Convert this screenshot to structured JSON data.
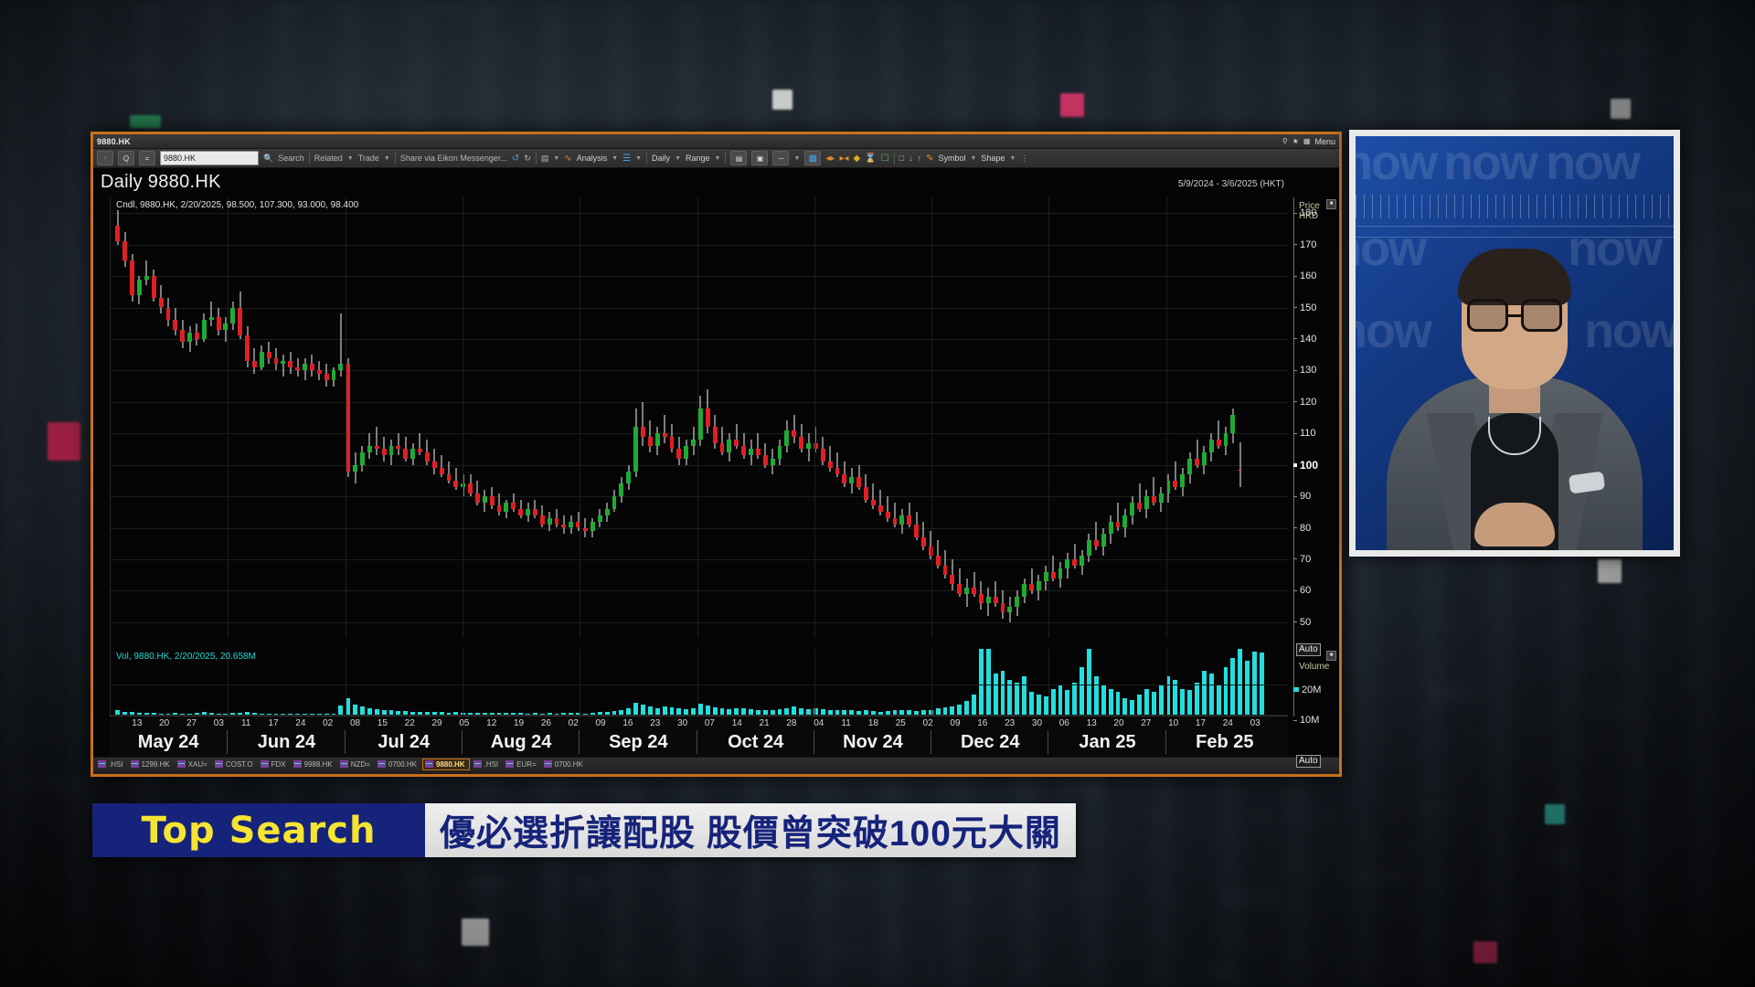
{
  "window": {
    "title": "9880.HK",
    "menu_label": "Menu",
    "titlebar_icons": [
      "pin-icon",
      "star-icon",
      "layout-icon"
    ]
  },
  "toolbar": {
    "up_arrow_icon": "↑",
    "quote_icon": "Q",
    "equals_icon": "=",
    "symbol_value": "9880.HK",
    "search_icon": "search-icon",
    "links": [
      "Search",
      "Related",
      "Trade",
      "Share via Eikon Messenger..."
    ],
    "undo_icon": "↺",
    "redo_icon": "↻",
    "folder_icon": "▤",
    "analysis_label": "Analysis",
    "layers_icon": "☰",
    "interval_label": "Daily",
    "range_label": "Range",
    "symbol_label": "Symbol",
    "shape_label": "Shape",
    "more_icon": "⋮"
  },
  "chart": {
    "heading": "Daily 9880.HK",
    "date_range": "5/9/2024 - 3/6/2025 (HKT)",
    "price_legend": "Cndl, 9880.HK, 2/20/2025, 98.500, 107.300, 93.000, 98.400",
    "volume_legend": "Vol, 9880.HK, 2/20/2025, 20.658M",
    "price_axis_caption": [
      "Price",
      "HKD"
    ],
    "volume_axis_caption": "Volume",
    "auto_label": "Auto",
    "price_ticks": [
      180,
      170,
      160,
      150,
      140,
      130,
      120,
      110,
      100,
      90,
      80,
      70,
      60,
      50
    ],
    "highlight_price": 100,
    "volume_ticks": [
      "20M",
      "10M"
    ],
    "colors": {
      "up": "#1faa34",
      "down": "#e01f22",
      "wick": "#f2f2f2",
      "volume": "#23dede",
      "background": "#050505",
      "window_border": "#c8701a"
    }
  },
  "chart_data": {
    "type": "line",
    "subtype": "candlestick-with-volume",
    "title": "Daily 9880.HK",
    "subtitle": "5/9/2024 - 3/6/2025 (HKT)",
    "xlabel": "",
    "ylabel": "Price HKD",
    "ylim": [
      45,
      185
    ],
    "grid": true,
    "legend_position": "top-left",
    "instrument": "9880.HK",
    "currency": "HKD",
    "latest_quote": {
      "date": "2/20/2025",
      "open": 98.5,
      "high": 107.3,
      "low": 93.0,
      "close": 98.4,
      "volume": "20.658M"
    },
    "price_tick_labels": [
      180,
      170,
      160,
      150,
      140,
      130,
      120,
      110,
      100,
      90,
      80,
      70,
      60,
      50
    ],
    "volume_tick_labels": [
      "20M",
      "10M"
    ],
    "months": [
      "May 24",
      "Jun 24",
      "Jul 24",
      "Aug 24",
      "Sep 24",
      "Oct 24",
      "Nov 24",
      "Dec 24",
      "Jan 25",
      "Feb 25"
    ],
    "day_ticks": [
      "13",
      "20",
      "27",
      "03",
      "11",
      "17",
      "24",
      "02",
      "08",
      "15",
      "22",
      "29",
      "05",
      "12",
      "19",
      "26",
      "02",
      "09",
      "16",
      "23",
      "30",
      "07",
      "14",
      "21",
      "28",
      "04",
      "11",
      "18",
      "25",
      "02",
      "09",
      "16",
      "23",
      "30",
      "06",
      "13",
      "20",
      "27",
      "10",
      "17",
      "24",
      "03"
    ],
    "candles": [
      {
        "o": 176,
        "h": 181,
        "l": 170,
        "c": 171
      },
      {
        "o": 171,
        "h": 174,
        "l": 163,
        "c": 165
      },
      {
        "o": 165,
        "h": 167,
        "l": 152,
        "c": 154
      },
      {
        "o": 154,
        "h": 160,
        "l": 151,
        "c": 159
      },
      {
        "o": 159,
        "h": 165,
        "l": 157,
        "c": 160
      },
      {
        "o": 160,
        "h": 162,
        "l": 152,
        "c": 153
      },
      {
        "o": 153,
        "h": 157,
        "l": 148,
        "c": 150
      },
      {
        "o": 150,
        "h": 153,
        "l": 144,
        "c": 146
      },
      {
        "o": 146,
        "h": 150,
        "l": 141,
        "c": 143
      },
      {
        "o": 143,
        "h": 146,
        "l": 137,
        "c": 139
      },
      {
        "o": 139,
        "h": 144,
        "l": 136,
        "c": 142
      },
      {
        "o": 142,
        "h": 145,
        "l": 138,
        "c": 140
      },
      {
        "o": 140,
        "h": 148,
        "l": 139,
        "c": 146
      },
      {
        "o": 146,
        "h": 152,
        "l": 144,
        "c": 147
      },
      {
        "o": 147,
        "h": 150,
        "l": 141,
        "c": 143
      },
      {
        "o": 143,
        "h": 147,
        "l": 139,
        "c": 145
      },
      {
        "o": 145,
        "h": 152,
        "l": 143,
        "c": 150
      },
      {
        "o": 150,
        "h": 155,
        "l": 140,
        "c": 141
      },
      {
        "o": 141,
        "h": 144,
        "l": 131,
        "c": 133
      },
      {
        "o": 133,
        "h": 137,
        "l": 129,
        "c": 131
      },
      {
        "o": 131,
        "h": 138,
        "l": 130,
        "c": 136
      },
      {
        "o": 136,
        "h": 139,
        "l": 132,
        "c": 134
      },
      {
        "o": 134,
        "h": 137,
        "l": 130,
        "c": 132
      },
      {
        "o": 132,
        "h": 135,
        "l": 128,
        "c": 133
      },
      {
        "o": 133,
        "h": 136,
        "l": 129,
        "c": 131
      },
      {
        "o": 131,
        "h": 134,
        "l": 128,
        "c": 130
      },
      {
        "o": 130,
        "h": 134,
        "l": 127,
        "c": 132
      },
      {
        "o": 132,
        "h": 135,
        "l": 128,
        "c": 130
      },
      {
        "o": 130,
        "h": 133,
        "l": 127,
        "c": 129
      },
      {
        "o": 129,
        "h": 132,
        "l": 125,
        "c": 127
      },
      {
        "o": 127,
        "h": 131,
        "l": 125,
        "c": 130
      },
      {
        "o": 130,
        "h": 148,
        "l": 128,
        "c": 132
      },
      {
        "o": 132,
        "h": 134,
        "l": 96,
        "c": 98
      },
      {
        "o": 98,
        "h": 104,
        "l": 94,
        "c": 100
      },
      {
        "o": 100,
        "h": 106,
        "l": 98,
        "c": 104
      },
      {
        "o": 104,
        "h": 110,
        "l": 102,
        "c": 106
      },
      {
        "o": 106,
        "h": 112,
        "l": 103,
        "c": 105
      },
      {
        "o": 105,
        "h": 109,
        "l": 101,
        "c": 103
      },
      {
        "o": 103,
        "h": 108,
        "l": 100,
        "c": 106
      },
      {
        "o": 106,
        "h": 110,
        "l": 103,
        "c": 105
      },
      {
        "o": 105,
        "h": 109,
        "l": 101,
        "c": 102
      },
      {
        "o": 102,
        "h": 107,
        "l": 100,
        "c": 105
      },
      {
        "o": 105,
        "h": 110,
        "l": 103,
        "c": 104
      },
      {
        "o": 104,
        "h": 108,
        "l": 100,
        "c": 101
      },
      {
        "o": 101,
        "h": 105,
        "l": 97,
        "c": 99
      },
      {
        "o": 99,
        "h": 103,
        "l": 96,
        "c": 97
      },
      {
        "o": 97,
        "h": 101,
        "l": 94,
        "c": 95
      },
      {
        "o": 95,
        "h": 99,
        "l": 92,
        "c": 93
      },
      {
        "o": 93,
        "h": 97,
        "l": 90,
        "c": 94
      },
      {
        "o": 94,
        "h": 97,
        "l": 90,
        "c": 91
      },
      {
        "o": 91,
        "h": 95,
        "l": 87,
        "c": 88
      },
      {
        "o": 88,
        "h": 92,
        "l": 85,
        "c": 90
      },
      {
        "o": 90,
        "h": 93,
        "l": 86,
        "c": 87
      },
      {
        "o": 87,
        "h": 91,
        "l": 84,
        "c": 85
      },
      {
        "o": 85,
        "h": 89,
        "l": 83,
        "c": 88
      },
      {
        "o": 88,
        "h": 91,
        "l": 85,
        "c": 86
      },
      {
        "o": 86,
        "h": 89,
        "l": 83,
        "c": 84
      },
      {
        "o": 84,
        "h": 88,
        "l": 82,
        "c": 86
      },
      {
        "o": 86,
        "h": 89,
        "l": 83,
        "c": 84
      },
      {
        "o": 84,
        "h": 87,
        "l": 80,
        "c": 81
      },
      {
        "o": 81,
        "h": 85,
        "l": 79,
        "c": 83
      },
      {
        "o": 83,
        "h": 86,
        "l": 80,
        "c": 81
      },
      {
        "o": 81,
        "h": 84,
        "l": 78,
        "c": 80
      },
      {
        "o": 80,
        "h": 84,
        "l": 78,
        "c": 82
      },
      {
        "o": 82,
        "h": 85,
        "l": 79,
        "c": 80
      },
      {
        "o": 80,
        "h": 83,
        "l": 77,
        "c": 79
      },
      {
        "o": 79,
        "h": 83,
        "l": 77,
        "c": 82
      },
      {
        "o": 82,
        "h": 86,
        "l": 80,
        "c": 84
      },
      {
        "o": 84,
        "h": 88,
        "l": 82,
        "c": 86
      },
      {
        "o": 86,
        "h": 92,
        "l": 85,
        "c": 90
      },
      {
        "o": 90,
        "h": 96,
        "l": 88,
        "c": 94
      },
      {
        "o": 94,
        "h": 100,
        "l": 92,
        "c": 98
      },
      {
        "o": 98,
        "h": 118,
        "l": 96,
        "c": 112
      },
      {
        "o": 112,
        "h": 120,
        "l": 106,
        "c": 109
      },
      {
        "o": 109,
        "h": 114,
        "l": 104,
        "c": 106
      },
      {
        "o": 106,
        "h": 112,
        "l": 103,
        "c": 110
      },
      {
        "o": 110,
        "h": 116,
        "l": 107,
        "c": 109
      },
      {
        "o": 109,
        "h": 113,
        "l": 104,
        "c": 105
      },
      {
        "o": 105,
        "h": 109,
        "l": 100,
        "c": 102
      },
      {
        "o": 102,
        "h": 108,
        "l": 100,
        "c": 106
      },
      {
        "o": 106,
        "h": 112,
        "l": 103,
        "c": 108
      },
      {
        "o": 108,
        "h": 122,
        "l": 106,
        "c": 118
      },
      {
        "o": 118,
        "h": 124,
        "l": 110,
        "c": 112
      },
      {
        "o": 112,
        "h": 116,
        "l": 105,
        "c": 107
      },
      {
        "o": 107,
        "h": 112,
        "l": 103,
        "c": 104
      },
      {
        "o": 104,
        "h": 110,
        "l": 101,
        "c": 108
      },
      {
        "o": 108,
        "h": 113,
        "l": 105,
        "c": 106
      },
      {
        "o": 106,
        "h": 110,
        "l": 102,
        "c": 103
      },
      {
        "o": 103,
        "h": 108,
        "l": 100,
        "c": 105
      },
      {
        "o": 105,
        "h": 110,
        "l": 102,
        "c": 103
      },
      {
        "o": 103,
        "h": 107,
        "l": 99,
        "c": 100
      },
      {
        "o": 100,
        "h": 105,
        "l": 97,
        "c": 102
      },
      {
        "o": 102,
        "h": 108,
        "l": 100,
        "c": 106
      },
      {
        "o": 106,
        "h": 114,
        "l": 104,
        "c": 111
      },
      {
        "o": 111,
        "h": 116,
        "l": 107,
        "c": 109
      },
      {
        "o": 109,
        "h": 113,
        "l": 104,
        "c": 105
      },
      {
        "o": 105,
        "h": 110,
        "l": 101,
        "c": 107
      },
      {
        "o": 107,
        "h": 112,
        "l": 104,
        "c": 105
      },
      {
        "o": 105,
        "h": 109,
        "l": 100,
        "c": 101
      },
      {
        "o": 101,
        "h": 106,
        "l": 98,
        "c": 99
      },
      {
        "o": 99,
        "h": 104,
        "l": 96,
        "c": 97
      },
      {
        "o": 97,
        "h": 101,
        "l": 93,
        "c": 94
      },
      {
        "o": 94,
        "h": 99,
        "l": 91,
        "c": 96
      },
      {
        "o": 96,
        "h": 100,
        "l": 92,
        "c": 93
      },
      {
        "o": 93,
        "h": 97,
        "l": 88,
        "c": 89
      },
      {
        "o": 89,
        "h": 94,
        "l": 86,
        "c": 87
      },
      {
        "o": 87,
        "h": 92,
        "l": 84,
        "c": 85
      },
      {
        "o": 85,
        "h": 90,
        "l": 82,
        "c": 83
      },
      {
        "o": 83,
        "h": 88,
        "l": 80,
        "c": 81
      },
      {
        "o": 81,
        "h": 86,
        "l": 78,
        "c": 84
      },
      {
        "o": 84,
        "h": 88,
        "l": 80,
        "c": 81
      },
      {
        "o": 81,
        "h": 85,
        "l": 76,
        "c": 77
      },
      {
        "o": 77,
        "h": 82,
        "l": 73,
        "c": 74
      },
      {
        "o": 74,
        "h": 79,
        "l": 70,
        "c": 71
      },
      {
        "o": 71,
        "h": 76,
        "l": 67,
        "c": 68
      },
      {
        "o": 68,
        "h": 73,
        "l": 64,
        "c": 65
      },
      {
        "o": 65,
        "h": 70,
        "l": 60,
        "c": 62
      },
      {
        "o": 62,
        "h": 67,
        "l": 58,
        "c": 59
      },
      {
        "o": 59,
        "h": 64,
        "l": 55,
        "c": 61
      },
      {
        "o": 61,
        "h": 66,
        "l": 58,
        "c": 59
      },
      {
        "o": 59,
        "h": 63,
        "l": 54,
        "c": 56
      },
      {
        "o": 56,
        "h": 61,
        "l": 52,
        "c": 58
      },
      {
        "o": 58,
        "h": 63,
        "l": 55,
        "c": 56
      },
      {
        "o": 56,
        "h": 60,
        "l": 51,
        "c": 53
      },
      {
        "o": 53,
        "h": 58,
        "l": 50,
        "c": 55
      },
      {
        "o": 55,
        "h": 60,
        "l": 52,
        "c": 58
      },
      {
        "o": 58,
        "h": 64,
        "l": 56,
        "c": 62
      },
      {
        "o": 62,
        "h": 67,
        "l": 59,
        "c": 60
      },
      {
        "o": 60,
        "h": 65,
        "l": 57,
        "c": 63
      },
      {
        "o": 63,
        "h": 68,
        "l": 60,
        "c": 66
      },
      {
        "o": 66,
        "h": 71,
        "l": 63,
        "c": 64
      },
      {
        "o": 64,
        "h": 69,
        "l": 61,
        "c": 67
      },
      {
        "o": 67,
        "h": 72,
        "l": 64,
        "c": 70
      },
      {
        "o": 70,
        "h": 75,
        "l": 67,
        "c": 68
      },
      {
        "o": 68,
        "h": 73,
        "l": 65,
        "c": 71
      },
      {
        "o": 71,
        "h": 78,
        "l": 69,
        "c": 76
      },
      {
        "o": 76,
        "h": 82,
        "l": 73,
        "c": 74
      },
      {
        "o": 74,
        "h": 80,
        "l": 71,
        "c": 78
      },
      {
        "o": 78,
        "h": 84,
        "l": 75,
        "c": 82
      },
      {
        "o": 82,
        "h": 88,
        "l": 79,
        "c": 80
      },
      {
        "o": 80,
        "h": 86,
        "l": 77,
        "c": 84
      },
      {
        "o": 84,
        "h": 90,
        "l": 81,
        "c": 88
      },
      {
        "o": 88,
        "h": 94,
        "l": 85,
        "c": 86
      },
      {
        "o": 86,
        "h": 92,
        "l": 83,
        "c": 90
      },
      {
        "o": 90,
        "h": 96,
        "l": 87,
        "c": 88
      },
      {
        "o": 88,
        "h": 93,
        "l": 85,
        "c": 91
      },
      {
        "o": 91,
        "h": 97,
        "l": 88,
        "c": 95
      },
      {
        "o": 95,
        "h": 101,
        "l": 92,
        "c": 93
      },
      {
        "o": 93,
        "h": 99,
        "l": 90,
        "c": 97
      },
      {
        "o": 97,
        "h": 104,
        "l": 94,
        "c": 102
      },
      {
        "o": 102,
        "h": 108,
        "l": 99,
        "c": 100
      },
      {
        "o": 100,
        "h": 106,
        "l": 97,
        "c": 104
      },
      {
        "o": 104,
        "h": 110,
        "l": 101,
        "c": 108
      },
      {
        "o": 108,
        "h": 114,
        "l": 105,
        "c": 106
      },
      {
        "o": 106,
        "h": 112,
        "l": 103,
        "c": 110
      },
      {
        "o": 110,
        "h": 118,
        "l": 107,
        "c": 116
      },
      {
        "o": 98.5,
        "h": 107.3,
        "l": 93,
        "c": 98.4
      }
    ],
    "volume_series_note": "Daily traded volume, cyan bars, peak approx 26M in Jan-Feb 2025",
    "volumes": [
      2,
      1.6,
      1.4,
      1.2,
      1.1,
      1.3,
      1,
      0.9,
      1.1,
      1,
      0.9,
      1.2,
      1.4,
      1.1,
      1,
      0.9,
      1.1,
      1.3,
      1.6,
      1.2,
      1,
      0.9,
      0.8,
      1,
      0.9,
      0.8,
      0.9,
      1,
      0.9,
      0.8,
      1,
      3.5,
      6,
      4,
      3.2,
      2.8,
      2.5,
      2.2,
      2,
      1.8,
      1.7,
      1.6,
      1.5,
      1.4,
      1.5,
      1.4,
      1.3,
      1.4,
      1.3,
      1.2,
      1.3,
      1.2,
      1.1,
      1.2,
      1.1,
      1.2,
      1.1,
      1,
      1.1,
      1,
      1.1,
      1,
      1.1,
      1.2,
      1.1,
      1,
      1.2,
      1.4,
      1.6,
      1.8,
      2.2,
      2.6,
      4.5,
      3.8,
      3.2,
      2.8,
      3.4,
      3,
      2.6,
      2.4,
      2.8,
      4.2,
      3.6,
      3,
      2.6,
      2.4,
      2.8,
      2.6,
      2.4,
      2.2,
      2,
      2.2,
      2.4,
      2.8,
      3.2,
      2.8,
      2.4,
      2.6,
      2.4,
      2.2,
      2,
      2.2,
      2,
      1.8,
      2,
      1.8,
      1.6,
      1.8,
      2,
      2.2,
      2,
      1.8,
      2,
      2.2,
      2.6,
      3,
      3.4,
      4,
      5,
      7,
      22,
      26,
      14,
      15,
      12,
      11,
      13,
      8,
      7,
      6.5,
      9,
      10,
      8.5,
      11,
      16,
      26,
      13,
      10,
      9,
      8,
      6,
      5.5,
      7,
      9,
      8,
      10,
      13,
      12,
      9,
      8.5,
      11,
      15,
      14,
      10,
      16,
      19,
      24,
      18,
      21,
      20.658
    ]
  },
  "statusbar": {
    "items": [
      {
        "label": ".HSI",
        "active": false
      },
      {
        "label": "1299.HK",
        "active": false
      },
      {
        "label": "XAU=",
        "active": false
      },
      {
        "label": "COST.O",
        "active": false
      },
      {
        "label": "FDX",
        "active": false
      },
      {
        "label": "9988.HK",
        "active": false
      },
      {
        "label": "NZD=",
        "active": false
      },
      {
        "label": "0700.HK",
        "active": false
      },
      {
        "label": "9880.HK",
        "active": true
      },
      {
        "label": ".HSI",
        "active": false
      },
      {
        "label": "EUR=",
        "active": false
      },
      {
        "label": "0700.HK",
        "active": false
      }
    ]
  },
  "banner": {
    "tag": "Top Search",
    "headline": "優必選折讓配股 股價曾突破100元大關",
    "tag_bg": "#16237a",
    "tag_fg": "#f5e431",
    "text_bg": "#e4e4e4",
    "text_fg": "#16237a"
  },
  "presenter": {
    "station_watermark": "now",
    "alt": "news anchor in grey blazer and black turtleneck"
  }
}
